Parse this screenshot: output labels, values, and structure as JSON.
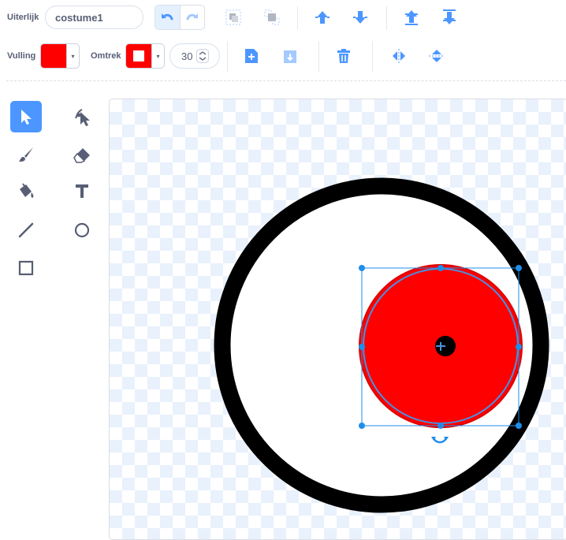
{
  "toolbar": {
    "costume_label": "Uiterlijk",
    "costume_name": "costume1",
    "fill_label": "Vulling",
    "outline_label": "Omtrek",
    "fill_color": "#ff0000",
    "outline_color": "#ff0000",
    "stroke_width": "30",
    "caret": "▾"
  },
  "colors": {
    "accent": "#4c97ff",
    "text": "#575e75",
    "handle": "#0b8ee8"
  },
  "tools": [
    "select-tool",
    "reshape-tool",
    "brush-tool",
    "eraser-tool",
    "fill-tool",
    "text-tool",
    "line-tool",
    "circle-tool",
    "rectangle-tool"
  ],
  "selected_tool": "select-tool"
}
